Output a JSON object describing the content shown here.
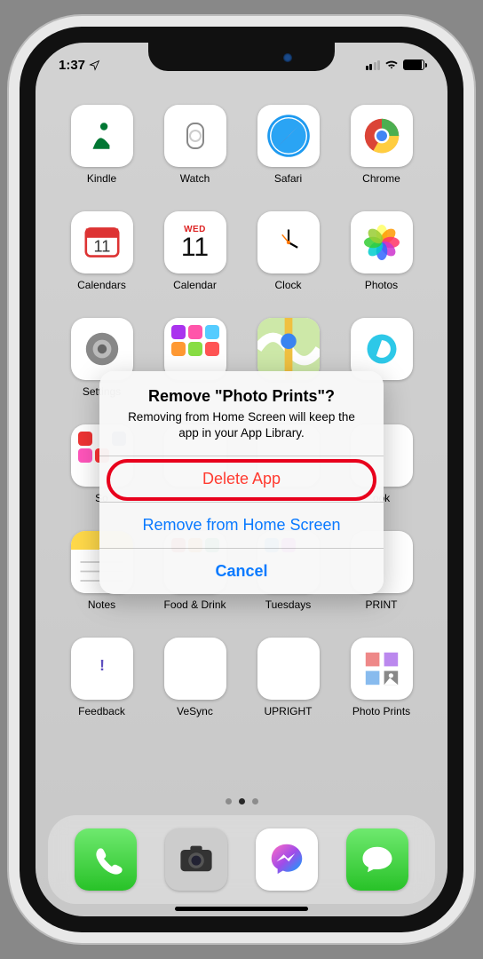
{
  "status": {
    "time": "1:37"
  },
  "calendar": {
    "day": "WED",
    "date": "11"
  },
  "apps": {
    "r1": [
      {
        "name": "kindle",
        "label": "Kindle"
      },
      {
        "name": "watch",
        "label": "Watch"
      },
      {
        "name": "safari",
        "label": "Safari"
      },
      {
        "name": "chrome",
        "label": "Chrome"
      }
    ],
    "r2": [
      {
        "name": "calendars",
        "label": "Calendars"
      },
      {
        "name": "calendar",
        "label": "Calendar"
      },
      {
        "name": "clock",
        "label": "Clock"
      },
      {
        "name": "photos",
        "label": "Photos"
      }
    ],
    "r3": [
      {
        "name": "settings",
        "label": "Settings"
      },
      {
        "name": "folder",
        "label": ""
      },
      {
        "name": "maps",
        "label": ""
      },
      {
        "name": "alexa",
        "label": ""
      }
    ],
    "r4": [
      {
        "name": "folder",
        "label": "So"
      },
      {
        "name": "folder",
        "label": ""
      },
      {
        "name": "folder",
        "label": ""
      },
      {
        "name": "facebook",
        "label": "ook"
      }
    ],
    "r5": [
      {
        "name": "notes",
        "label": "Notes"
      },
      {
        "name": "folder",
        "label": "Food & Drink"
      },
      {
        "name": "folder",
        "label": "Tuesdays"
      },
      {
        "name": "canon",
        "label": "PRINT"
      }
    ],
    "r6": [
      {
        "name": "feedback",
        "label": "Feedback"
      },
      {
        "name": "vesync",
        "label": "VeSync"
      },
      {
        "name": "upright",
        "label": "UPRIGHT"
      },
      {
        "name": "photoprints",
        "label": "Photo Prints"
      }
    ]
  },
  "dialog": {
    "title": "Remove \"Photo Prints\"?",
    "message": "Removing from Home Screen will keep the app in your App Library.",
    "delete": "Delete App",
    "remove": "Remove from Home Screen",
    "cancel": "Cancel"
  }
}
